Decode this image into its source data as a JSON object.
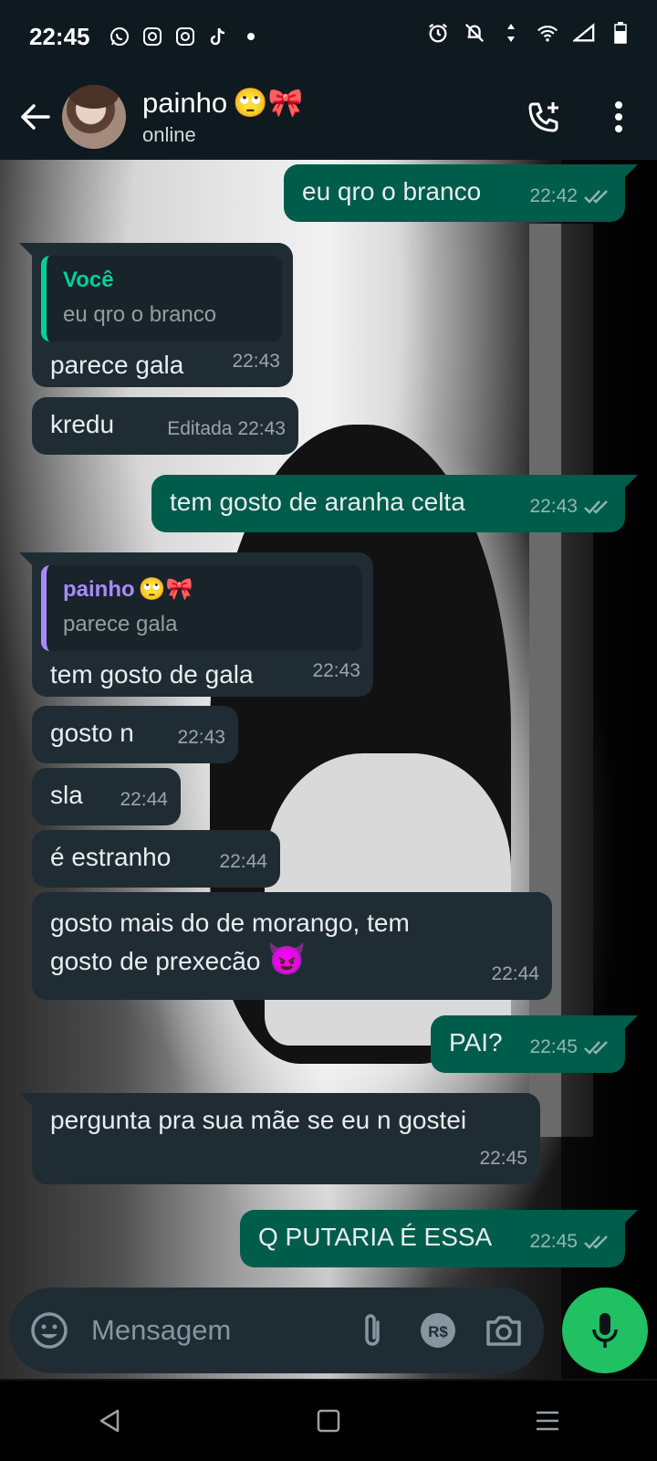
{
  "status_bar": {
    "time": "22:45"
  },
  "header": {
    "contact_name": "painho",
    "name_emoji": "🙄🎀",
    "status": "online"
  },
  "messages": [
    {
      "dir": "out",
      "text": "eu qro o branco",
      "time": "22:42",
      "read": true
    },
    {
      "dir": "in",
      "quote_author": "Você",
      "quote_text": "eu qro o branco",
      "text": "parece gala",
      "time": "22:43"
    },
    {
      "dir": "in",
      "text": "kredu",
      "edited": "Editada",
      "time": "22:43"
    },
    {
      "dir": "out",
      "text": "tem gosto de aranha celta",
      "time": "22:43",
      "read": true
    },
    {
      "dir": "in",
      "quote_author": "painho",
      "quote_author_emoji": "🙄🎀",
      "quote_text": "parece gala",
      "text": "tem gosto de gala",
      "time": "22:43"
    },
    {
      "dir": "in",
      "text": "gosto n",
      "time": "22:43"
    },
    {
      "dir": "in",
      "text": "sla",
      "time": "22:44"
    },
    {
      "dir": "in",
      "text": "é estranho",
      "time": "22:44"
    },
    {
      "dir": "in",
      "text_line1": "gosto mais do de morango, tem",
      "text_line2": "gosto de prexecão",
      "emoji": "😈",
      "time": "22:44"
    },
    {
      "dir": "out",
      "text": "PAI?",
      "time": "22:45",
      "read": true
    },
    {
      "dir": "in",
      "text": "pergunta pra sua mãe se eu n gostei",
      "time": "22:45"
    },
    {
      "dir": "out",
      "text": "Q PUTARIA É ESSA",
      "time": "22:45",
      "read": true
    }
  ],
  "composer": {
    "placeholder": "Mensagem"
  },
  "colors": {
    "outgoing_bubble": "#005c4b",
    "incoming_bubble": "#1f2c34",
    "accent_green": "#21c063",
    "quote_you": "#06cf9c",
    "quote_contact": "#a78bfa",
    "tick_read": "#8fb6ad"
  }
}
